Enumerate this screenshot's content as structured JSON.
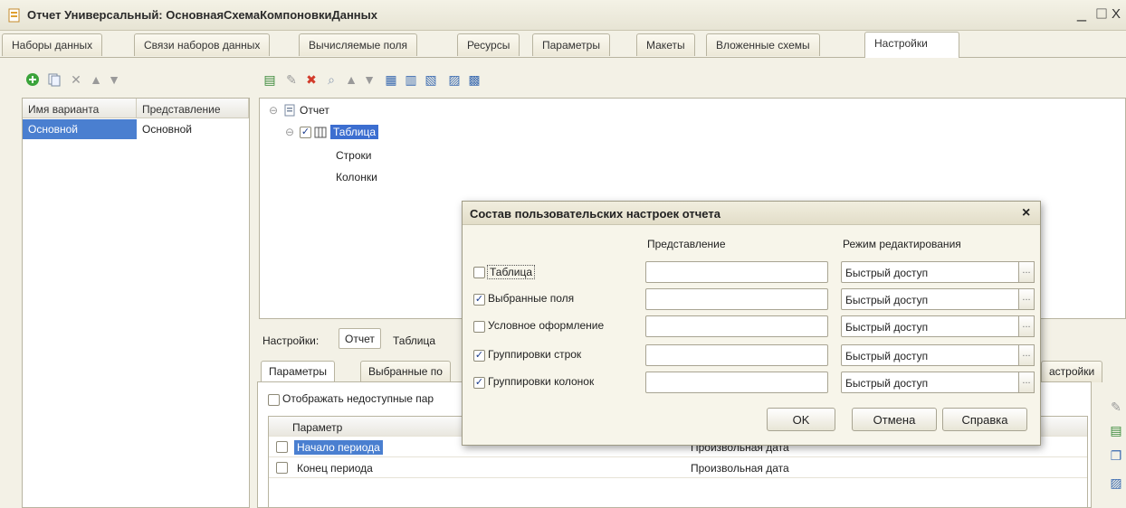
{
  "window": {
    "title": "Отчет Универсальный: ОсновнаяСхемаКомпоновкиДанных",
    "min": "_",
    "close": "X"
  },
  "tabs": [
    {
      "label": "Наборы данных"
    },
    {
      "label": "Связи наборов данных"
    },
    {
      "label": "Вычисляемые поля"
    },
    {
      "label": "Ресурсы"
    },
    {
      "label": "Параметры"
    },
    {
      "label": "Макеты"
    },
    {
      "label": "Вложенные схемы"
    },
    {
      "label": "Настройки"
    }
  ],
  "variants": {
    "headers": [
      "Имя варианта",
      "Представление"
    ],
    "rows": [
      [
        "Основной",
        "Основной"
      ]
    ]
  },
  "tree": {
    "root": "Отчет",
    "table": "Таблица",
    "rows": "Строки",
    "columns": "Колонки"
  },
  "settings_bar": {
    "label": "Настройки:",
    "report_button": "Отчет",
    "table_label": "Таблица"
  },
  "bottom_tabs": [
    {
      "label": "Параметры"
    },
    {
      "label": "Выбранные по"
    },
    {
      "label": "астройки"
    }
  ],
  "param_panel": {
    "show_unavailable": "Отображать недоступные пар",
    "column_header": "Параметр",
    "rows": [
      {
        "name": "Начало периода",
        "type": "Произвольная дата"
      },
      {
        "name": "Конец периода",
        "type": "Произвольная дата"
      }
    ]
  },
  "dialog": {
    "title": "Состав пользовательских настроек отчета",
    "close": "×",
    "col_presentation": "Представление",
    "col_mode": "Режим редактирования",
    "rows": [
      {
        "label": "Таблица",
        "checked": false,
        "mode": "Быстрый доступ"
      },
      {
        "label": "Выбранные поля",
        "checked": true,
        "mode": "Быстрый доступ"
      },
      {
        "label": "Условное оформление",
        "checked": false,
        "mode": "Быстрый доступ"
      },
      {
        "label": "Группировки строк",
        "checked": true,
        "mode": "Быстрый доступ"
      },
      {
        "label": "Группировки колонок",
        "checked": true,
        "mode": "Быстрый доступ"
      }
    ],
    "ellipsis": "...",
    "ok": "OK",
    "cancel": "Отмена",
    "help": "Справка"
  }
}
